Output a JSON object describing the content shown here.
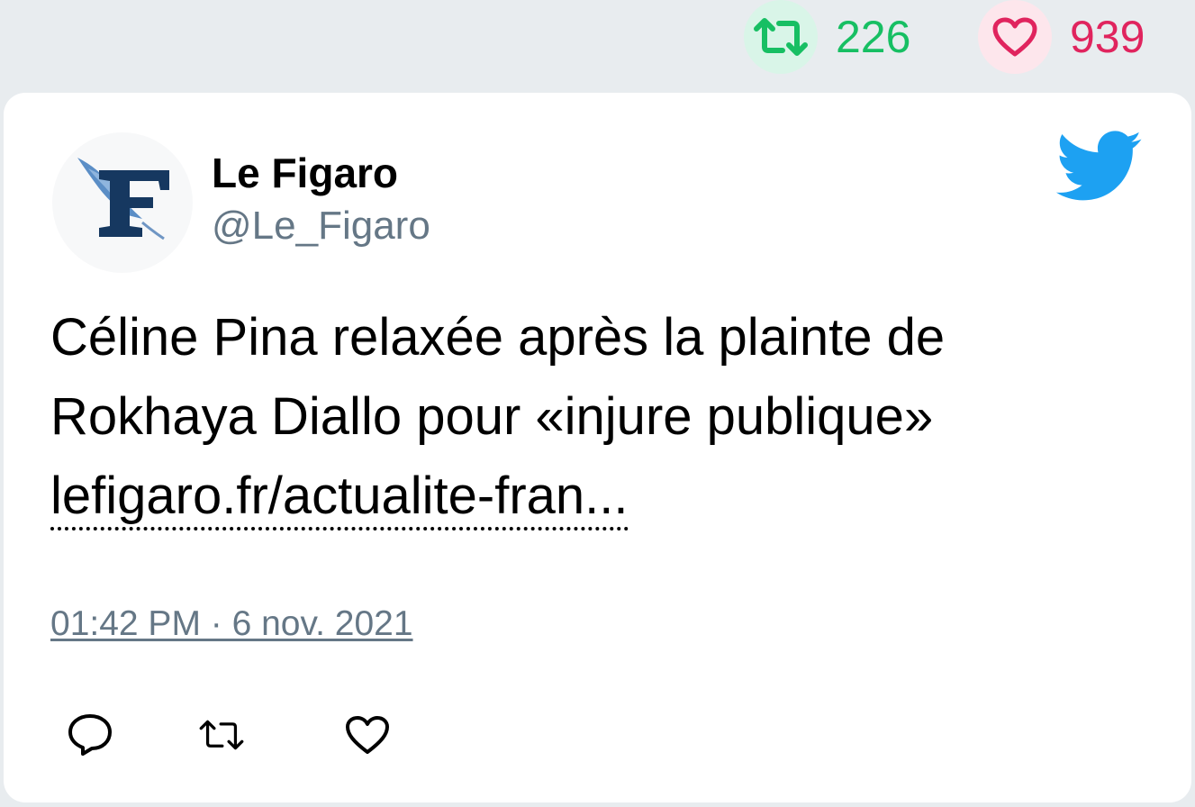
{
  "stats": {
    "retweets": "226",
    "likes": "939"
  },
  "tweet": {
    "author_name": "Le Figaro",
    "author_handle": "@Le_Figaro",
    "text_line1": "Céline Pina relaxée après la plainte de",
    "text_line2": "Rokhaya Diallo pour «injure publique»",
    "link_text": "lefigaro.fr/actualite-fran...",
    "timestamp": "01:42 PM · 6 nov. 2021"
  },
  "icons": {
    "retweet": "retweet-icon",
    "like": "heart-icon",
    "reply": "reply-icon",
    "brand": "twitter-bird-icon",
    "avatar": "le-figaro-logo"
  },
  "colors": {
    "retweet_green": "#17bf63",
    "like_red": "#e0245e",
    "twitter_blue": "#1da1f2",
    "secondary_text": "#657786",
    "figaro_navy": "#163860"
  }
}
